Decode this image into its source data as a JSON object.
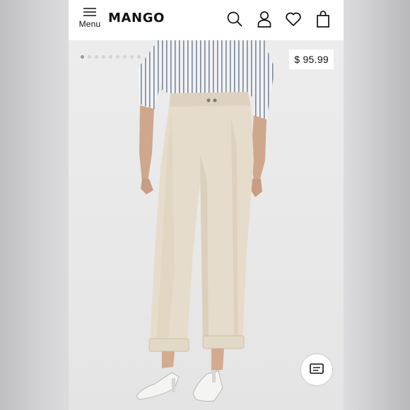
{
  "header": {
    "menu_label": "Menu",
    "logo_text": "MANGO",
    "icons": [
      "menu-icon",
      "search-icon",
      "account-icon",
      "wishlist-heart-icon",
      "shopping-bag-icon"
    ]
  },
  "product": {
    "price": "$ 95.99",
    "gallery_dots": 9,
    "gallery_active_index": 0,
    "image_alt_icon": "product-photo"
  },
  "chat": {
    "icon": "chat-icon"
  },
  "colors": {
    "header_bg": "#ffffff",
    "text": "#111111",
    "background": "#e9e9e9",
    "pants": "#e6dccb",
    "shirt_stripe": "#7c8797"
  }
}
